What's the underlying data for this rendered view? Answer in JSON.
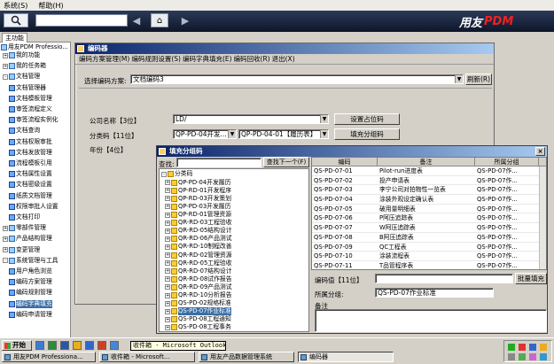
{
  "menubar": {
    "items": [
      "系统(S)",
      "帮助(H)"
    ]
  },
  "brand": {
    "text": "用友",
    "pdm": "PDM"
  },
  "left_panel": {
    "tab": "主功能",
    "root": "用友PDM Professio...",
    "items": [
      {
        "label": "我的功能",
        "level": 1,
        "exp": "+"
      },
      {
        "label": "我的任务箱",
        "level": 1,
        "exp": "+"
      },
      {
        "label": "文档管理",
        "level": 1,
        "exp": "-"
      },
      {
        "label": "文档管理器",
        "level": 2
      },
      {
        "label": "文档模板管理",
        "level": 2
      },
      {
        "label": "审签流程定义",
        "level": 2
      },
      {
        "label": "审签流程实例化",
        "level": 2
      },
      {
        "label": "文档查询",
        "level": 2
      },
      {
        "label": "文档权限审批",
        "level": 2
      },
      {
        "label": "文档发放管理",
        "level": 2
      },
      {
        "label": "流程模板引用",
        "level": 2
      },
      {
        "label": "文档属性设置",
        "level": 2
      },
      {
        "label": "文档密级设置",
        "level": 2
      },
      {
        "label": "纸质文档管理",
        "level": 2
      },
      {
        "label": "权限审批人设置",
        "level": 2
      },
      {
        "label": "文档打印",
        "level": 2
      },
      {
        "label": "零部件管理",
        "level": 1,
        "exp": "+"
      },
      {
        "label": "产品结构管理",
        "level": 1,
        "exp": "+"
      },
      {
        "label": "变更管理",
        "level": 1,
        "exp": "+"
      },
      {
        "label": "系统管理与工具",
        "level": 1,
        "exp": "-"
      },
      {
        "label": "用户角色浏览",
        "level": 2
      },
      {
        "label": "编码方案管理",
        "level": 2
      },
      {
        "label": "编码规则管理",
        "level": 2
      },
      {
        "label": "编码字典填充",
        "level": 2,
        "selected": true
      },
      {
        "label": "编码申请管理",
        "level": 2
      }
    ]
  },
  "main_window": {
    "title": "编码器",
    "menu": [
      "编码方案管理(M)",
      "编码规则设置(S)",
      "编码字典填充(E)",
      "编码回收(R)",
      "退出(X)"
    ],
    "scheme_label": "选择编码方案:",
    "scheme_value": "文档编码3",
    "refresh_label": "刷新(R)",
    "rows": [
      {
        "label": "公司名称【3位】",
        "value": "LD/",
        "value2": "",
        "button": "设置占位码"
      },
      {
        "label": "分类码【11位】",
        "value": "QP-PD-04开发...",
        "value2": "QP-PD-04-01【履历表】",
        "button": "填充分组码"
      },
      {
        "label": "年份【4位】",
        "value": "",
        "value2": "",
        "button": ""
      }
    ]
  },
  "popup": {
    "title": "填充分组码",
    "search_label": "查找:",
    "find_next_label": "查找下一个(F)",
    "tree_root": "分类码",
    "tree_items": [
      "QP-PD-04开发履历",
      "QP-RD-01开发程序",
      "QP-RD-03开发策划",
      "QP-PD-03开发履历",
      "QP-RD-01管理资源",
      "QR-RD-03工程验收",
      "QR-RD-05结构设计",
      "QR-RD-06产品测试",
      "QR-RD-10制程改善",
      "QR-RD-02管理资源",
      "QR-RD-05工程验收",
      "QR-RD-07结构设计",
      "QR-RD-08试作报告",
      "QR-RD-09产品测试",
      "QR-RD-10分析报告",
      "QS-PD-02规格标准",
      "QS-PD-07作业标准",
      "QS-PD-08工程通知",
      "QS-PD-08工程事务"
    ],
    "selected_index": 16,
    "grid_headers": [
      "编码",
      "备注",
      "所属分组"
    ],
    "grid_rows": [
      [
        "QS-PD-07-01",
        "Pilot-run进度表",
        "QS-PD-07作..."
      ],
      [
        "QS-PD-07-02",
        "投产申请表",
        "QS-PD-07作..."
      ],
      [
        "QS-PD-07-03",
        "李宁公司对拍物性一览表",
        "QS-PD-07作..."
      ],
      [
        "QS-PD-07-04",
        "涂装外观设定确认表",
        "QS-PD-07作..."
      ],
      [
        "QS-PD-07-05",
        "破用量明细表",
        "QS-PD-07作..."
      ],
      [
        "QS-PD-07-06",
        "P阿压追踪表",
        "QS-PD-07作..."
      ],
      [
        "QS-PD-07-07",
        "W阿压追踪表",
        "QS-PD-07作..."
      ],
      [
        "QS-PD-07-08",
        "B阿压追踪表",
        "QS-PD-07作..."
      ],
      [
        "QS-PD-07-09",
        "QC工程表",
        "QS-PD-07作..."
      ],
      [
        "QS-PD-07-10",
        "涂装流程表",
        "QS-PD-07作..."
      ],
      [
        "QS-PD-07-11",
        "T品管程序表",
        "QS-PD-07作..."
      ]
    ],
    "code_label": "编码值【11位】",
    "batch_fill_label": "批量填充",
    "group_label": "所属分组:",
    "group_value": "QS-PD-07作业标准",
    "remark_label": "备注"
  },
  "taskbar": {
    "start": "开始",
    "tooltip": "收件箱 - Microsoft Outlook",
    "tasks": [
      {
        "label": "用友PDM Professiona...",
        "active": false
      },
      {
        "label": "收件箱 - Microsoft...",
        "active": false
      },
      {
        "label": "用友产品数据管理系统",
        "active": false
      },
      {
        "label": "编码器",
        "active": true
      }
    ]
  }
}
